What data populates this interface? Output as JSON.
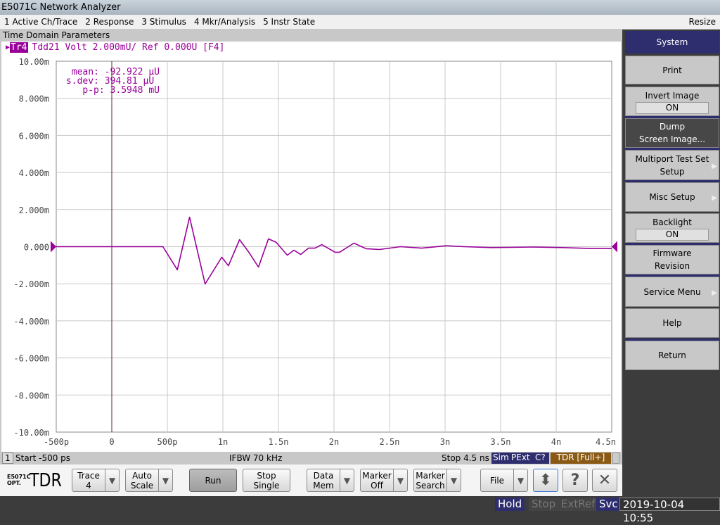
{
  "window": {
    "title": "E5071C Network Analyzer"
  },
  "menu": {
    "items": [
      "1 Active Ch/Trace",
      "2 Response",
      "3 Stimulus",
      "4 Mkr/Analysis",
      "5 Instr State"
    ],
    "resize": "Resize"
  },
  "panel": {
    "header": "Time Domain Parameters"
  },
  "trace": {
    "tag": "Tr4",
    "info": "Tdd21 Volt 2.000mU/ Ref 0.000U [F4]",
    "color": "#990099"
  },
  "stats": {
    "mean_label": "mean:",
    "mean": "-92.922 µU",
    "sdev_label": "s.dev:",
    "sdev": "394.81 µU",
    "pp_label": "p-p:",
    "pp": "3.5948 mU"
  },
  "status": {
    "channel": "1",
    "start": "Start -500 ps",
    "ifbw": "IFBW 70 kHz",
    "stop": "Stop 4.5 ns",
    "badges": [
      "Sim",
      "PExt",
      "C?"
    ],
    "tdr": "TDR [Full+]"
  },
  "toolbar": {
    "logo_small1": "E5071C",
    "logo_small2": "OPT.",
    "logo_big": "TDR",
    "trace": [
      "Trace",
      "4"
    ],
    "autoscale": [
      "Auto",
      "Scale"
    ],
    "run": "Run",
    "stop": [
      "Stop",
      "Single"
    ],
    "datamem": [
      "Data",
      "Mem"
    ],
    "markeroff": [
      "Marker",
      "Off"
    ],
    "markersearch": [
      "Marker",
      "Search"
    ],
    "file": "File",
    "help": "?",
    "close": "✕",
    "updown": "⬍"
  },
  "bottom": {
    "hold": "Hold",
    "stop": "Stop",
    "extref": "ExtRef",
    "svc": "Svc",
    "datetime": "2019-10-04 10:55"
  },
  "softkeys": {
    "title": "System",
    "print": "Print",
    "invert": "Invert Image",
    "invert_val": "ON",
    "dump1": "Dump",
    "dump2": "Screen Image...",
    "multiport1": "Multiport Test Set",
    "multiport2": "Setup",
    "misc": "Misc Setup",
    "backlight": "Backlight",
    "backlight_val": "ON",
    "firmware1": "Firmware",
    "firmware2": "Revision",
    "service": "Service Menu",
    "help": "Help",
    "return": "Return"
  },
  "chart_data": {
    "type": "line",
    "xlim": [
      -0.5,
      4.5
    ],
    "ylim": [
      -10,
      10
    ],
    "x_unit": "ns",
    "y_unit": "mV",
    "xticks": [
      "-500p",
      "0",
      "500p",
      "1n",
      "1.5n",
      "2n",
      "2.5n",
      "3n",
      "3.5n",
      "4n",
      "4.5n"
    ],
    "yticks": [
      "10.00m",
      "8.000m",
      "6.000m",
      "4.000m",
      "2.000m",
      "0.000",
      "-2.000m",
      "-4.000m",
      "-6.000m",
      "-8.000m",
      "-10.00m"
    ],
    "grid": true,
    "series": [
      {
        "name": "Tdd21",
        "color": "#990099",
        "x": [
          -0.5,
          0.46,
          0.59,
          0.7,
          0.84,
          0.99,
          1.05,
          1.15,
          1.23,
          1.32,
          1.41,
          1.48,
          1.58,
          1.64,
          1.7,
          1.77,
          1.83,
          1.89,
          2.01,
          2.05,
          2.18,
          2.29,
          2.41,
          2.6,
          2.79,
          3.01,
          3.17,
          3.42,
          3.8,
          4.06,
          4.31,
          4.5
        ],
        "y": [
          0,
          0,
          -1.25,
          1.59,
          -2.01,
          -0.57,
          -1.03,
          0.38,
          -0.27,
          -1.1,
          0.42,
          0.23,
          -0.46,
          -0.19,
          -0.42,
          -0.08,
          -0.08,
          0.11,
          -0.3,
          -0.3,
          0.19,
          -0.11,
          -0.15,
          0.0,
          -0.08,
          0.05,
          0.0,
          -0.05,
          -0.02,
          -0.05,
          -0.1,
          -0.1
        ]
      }
    ]
  }
}
